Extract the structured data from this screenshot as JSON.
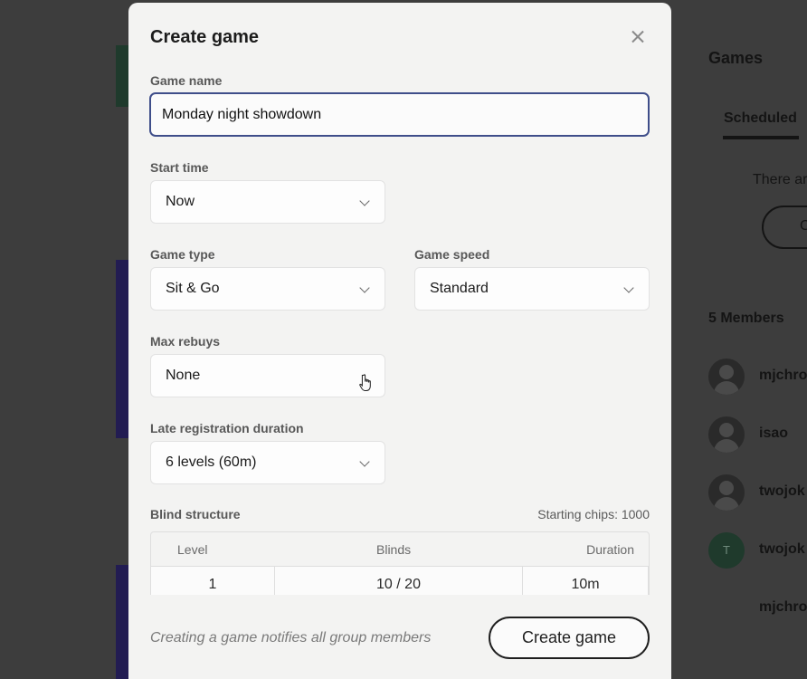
{
  "background": {
    "right_panel": {
      "title": "Games",
      "tab_scheduled": "Scheduled",
      "empty_text": "There ar",
      "pill_text": "C",
      "members_heading": "5 Members",
      "members": [
        {
          "name": "mjchro"
        },
        {
          "name": "isao"
        },
        {
          "name": "twojok"
        },
        {
          "name": "twojok",
          "initial": "T"
        },
        {
          "name": "mjchro"
        }
      ]
    }
  },
  "modal": {
    "title": "Create game",
    "game_name": {
      "label": "Game name",
      "value": "Monday night showdown"
    },
    "start_time": {
      "label": "Start time",
      "value": "Now"
    },
    "game_type": {
      "label": "Game type",
      "value": "Sit & Go"
    },
    "game_speed": {
      "label": "Game speed",
      "value": "Standard"
    },
    "max_rebuys": {
      "label": "Max rebuys",
      "value": "None"
    },
    "late_registration": {
      "label": "Late registration duration",
      "value": "6 levels (60m)"
    },
    "blind_structure": {
      "label": "Blind structure",
      "starting_chips": "Starting chips: 1000",
      "columns": [
        "Level",
        "Blinds",
        "Duration"
      ],
      "rows": [
        [
          "1",
          "10 / 20",
          "10m"
        ]
      ]
    },
    "footer": {
      "note": "Creating a game notifies all group members",
      "create_label": "Create game"
    }
  }
}
